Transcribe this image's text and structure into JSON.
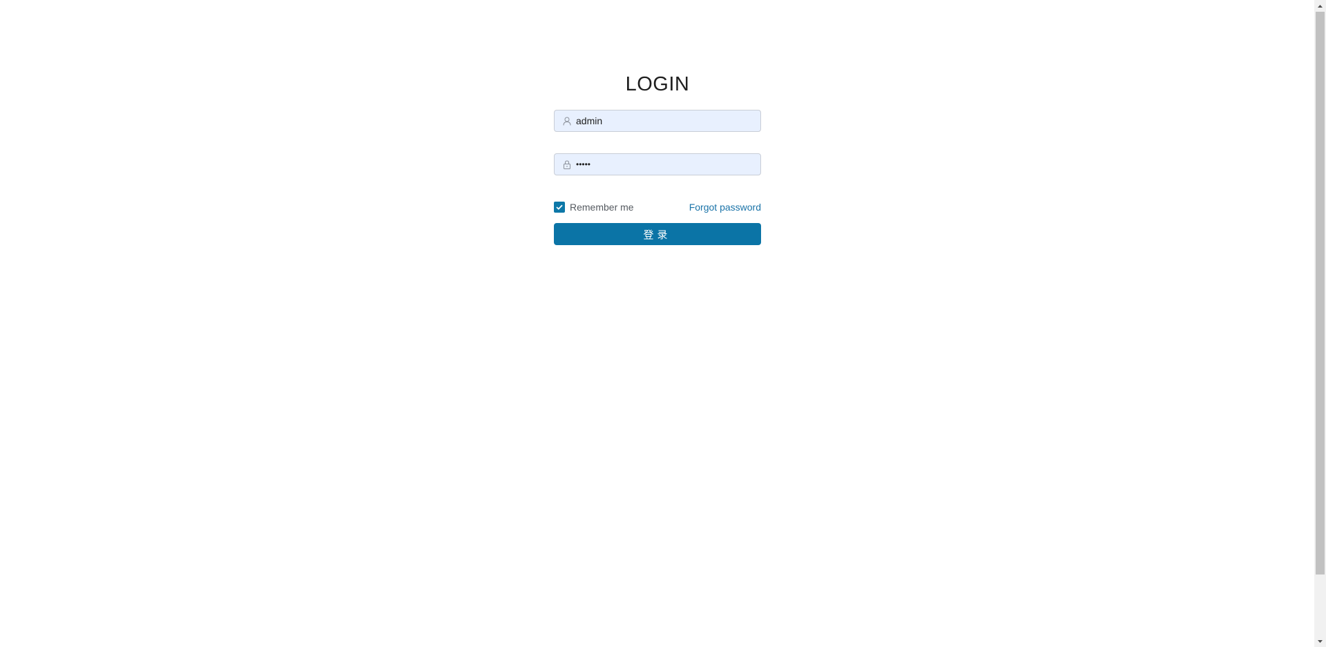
{
  "login": {
    "title": "LOGIN",
    "username": {
      "value": "admin",
      "icon": "user-icon"
    },
    "password": {
      "value": "•••••",
      "icon": "lock-icon"
    },
    "remember_me": {
      "label": "Remember me",
      "checked": true
    },
    "forgot_password_label": "Forgot password",
    "submit_label": "登录"
  },
  "colors": {
    "accent": "#0b74a6",
    "input_background": "#e8f0fe",
    "link": "#1a73a8"
  }
}
